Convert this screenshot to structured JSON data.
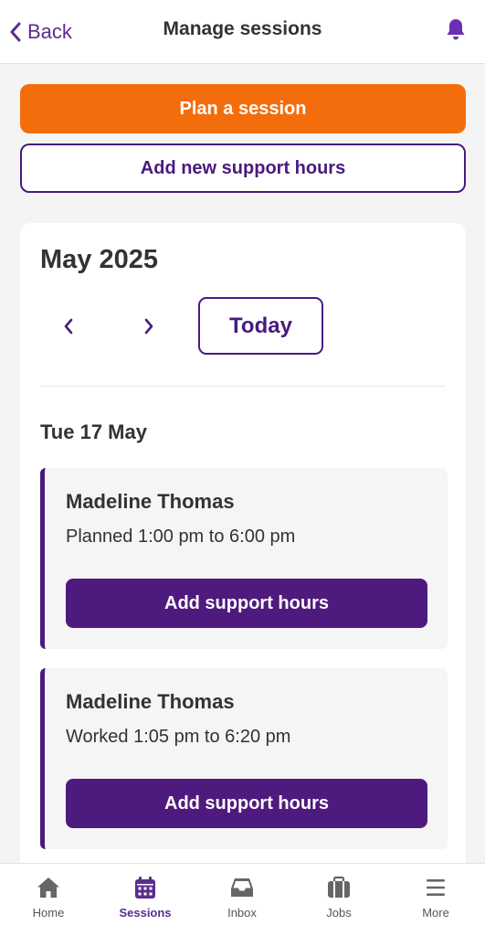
{
  "header": {
    "back_label": "Back",
    "title": "Manage sessions"
  },
  "actions": {
    "plan_label": "Plan a session",
    "add_hours_label": "Add new support hours"
  },
  "calendar": {
    "month": "May 2025",
    "today_label": "Today",
    "date_heading": "Tue 17 May"
  },
  "sessions": [
    {
      "name": "Madeline Thomas",
      "time": "Planned 1:00 pm to 6:00 pm",
      "button": "Add support hours"
    },
    {
      "name": "Madeline Thomas",
      "time": "Worked 1:05 pm to 6:20 pm",
      "button": "Add support hours"
    }
  ],
  "bottom_nav": [
    {
      "label": "Home",
      "icon": "home-icon",
      "active": false
    },
    {
      "label": "Sessions",
      "icon": "calendar-icon",
      "active": true
    },
    {
      "label": "Inbox",
      "icon": "inbox-icon",
      "active": false
    },
    {
      "label": "Jobs",
      "icon": "briefcase-icon",
      "active": false
    },
    {
      "label": "More",
      "icon": "menu-icon",
      "active": false
    }
  ],
  "colors": {
    "accent_purple": "#4a1a7e",
    "orange": "#f46d0d",
    "icon_grey": "#666666"
  }
}
